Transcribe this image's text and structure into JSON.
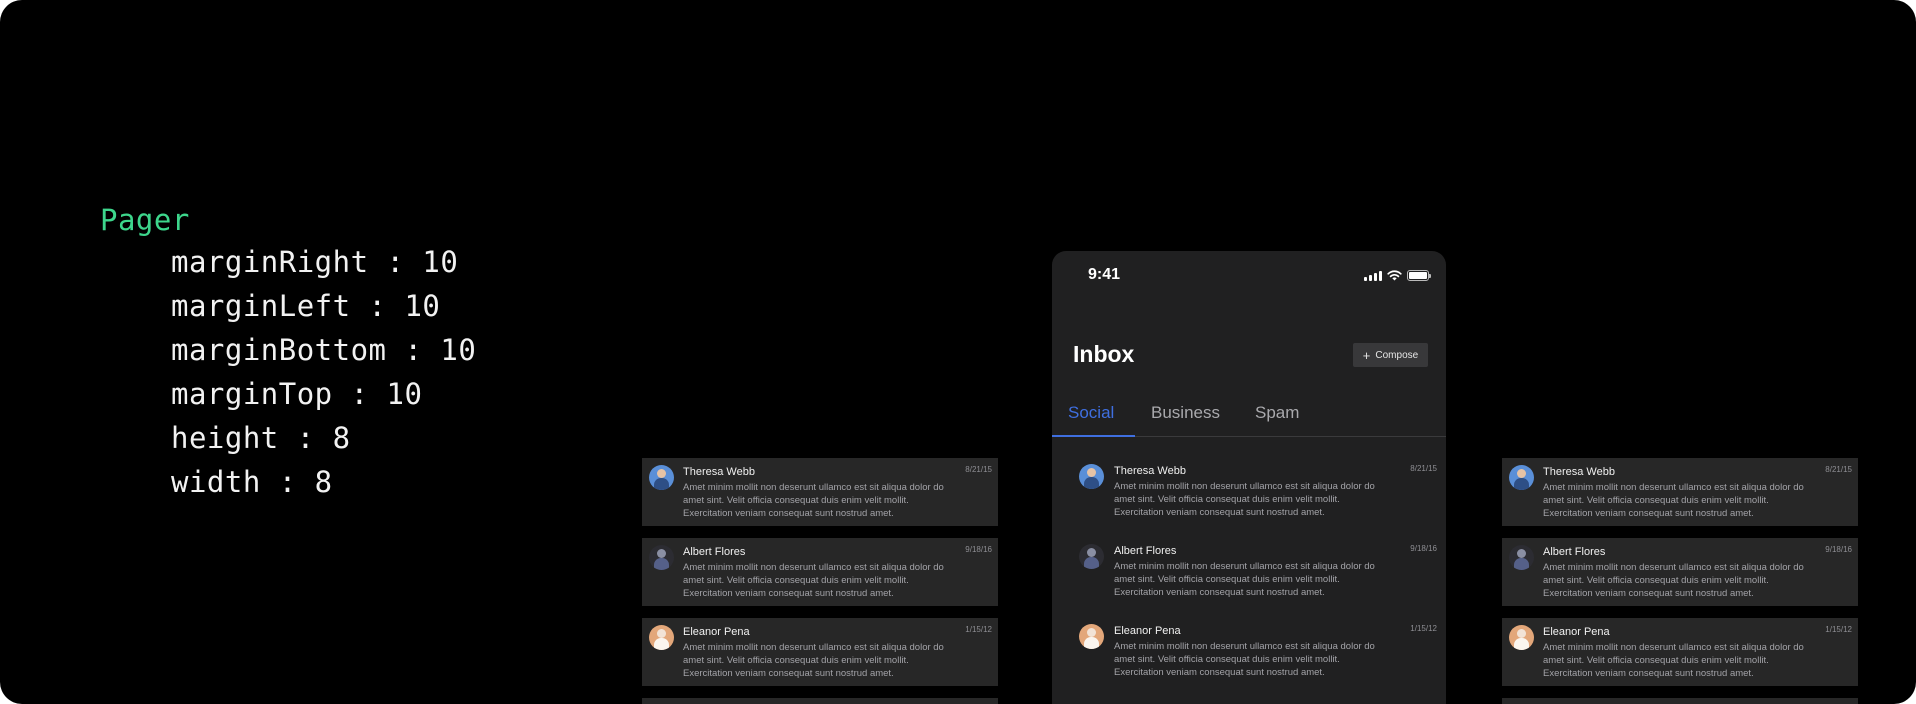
{
  "code": {
    "title": "Pager",
    "props": [
      "marginRight : 10",
      "marginLeft : 10",
      "marginBottom : 10",
      "marginTop : 10",
      "height : 8",
      "width : 8"
    ]
  },
  "status": {
    "time": "9:41"
  },
  "inbox": {
    "title": "Inbox",
    "compose_icon": "+",
    "compose_label": "Compose"
  },
  "tabs": [
    {
      "label": "Social",
      "active": true
    },
    {
      "label": "Business",
      "active": false
    },
    {
      "label": "Spam",
      "active": false
    }
  ],
  "messages": [
    {
      "name": "Theresa Webb",
      "date": "8/21/15",
      "text": "Amet minim mollit non deserunt ullamco est sit aliqua dolor do amet sint. Velit officia consequat duis enim velit mollit. Exercitation veniam consequat sunt nostrud amet.",
      "avatar": "avatar-theresa-webb"
    },
    {
      "name": "Albert Flores",
      "date": "9/18/16",
      "text": "Amet minim mollit non deserunt ullamco est sit aliqua dolor do amet sint. Velit officia consequat duis enim velit mollit. Exercitation veniam consequat sunt nostrud amet.",
      "avatar": "avatar-albert-flores"
    },
    {
      "name": "Eleanor Pena",
      "date": "1/15/12",
      "text": "Amet minim mollit non deserunt ullamco est sit aliqua dolor do amet sint. Velit officia consequat duis enim velit mollit. Exercitation veniam consequat sunt nostrud amet.",
      "avatar": "avatar-eleanor-pena"
    }
  ],
  "colors": {
    "accent": "#3f6fe0",
    "code_title": "#3dd68c",
    "card": "#272727",
    "phone_bg": "#202021"
  }
}
